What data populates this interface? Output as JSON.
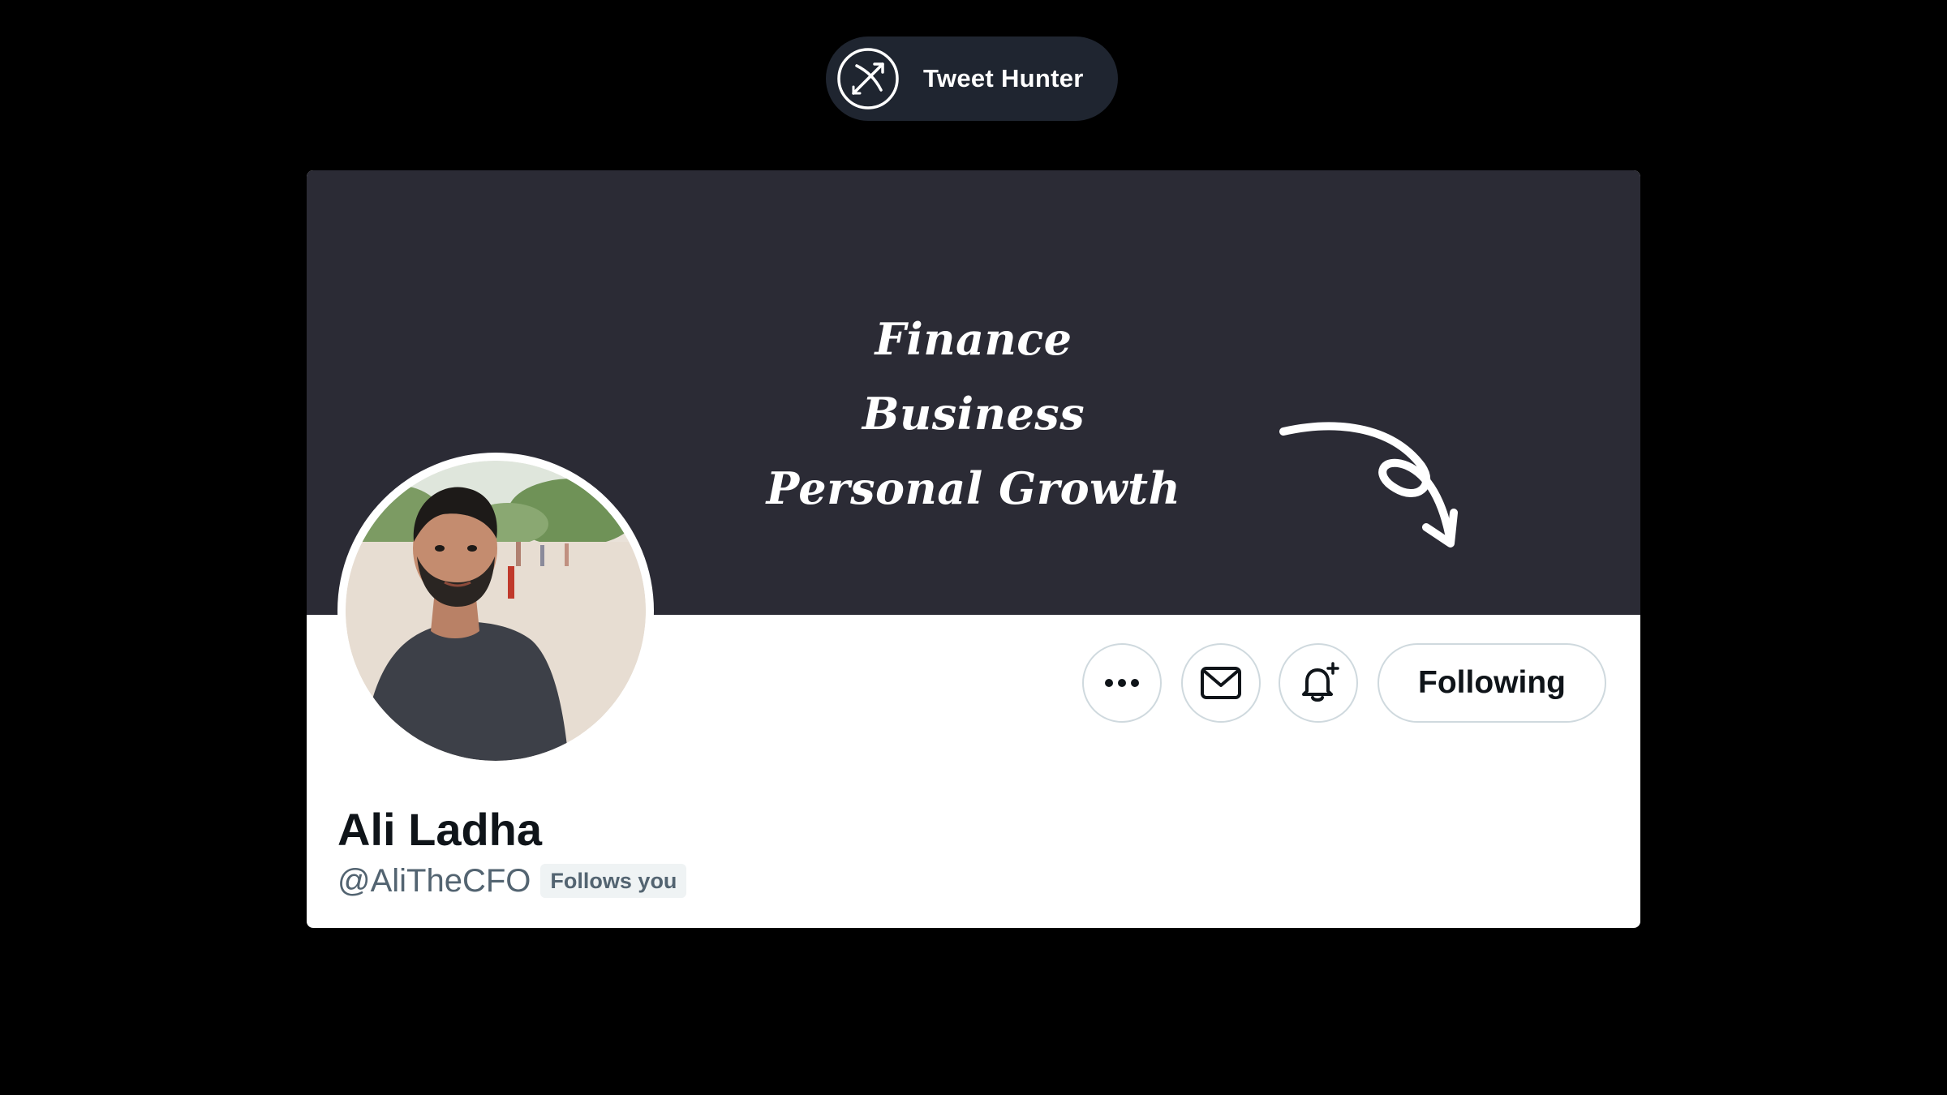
{
  "brand": {
    "name": "Tweet Hunter",
    "logo_icon": "bow-and-arrow-icon"
  },
  "banner": {
    "lines": [
      "Finance",
      "Business",
      "Personal Growth"
    ],
    "background": "#2b2b35",
    "arrow_icon": "curly-arrow-icon"
  },
  "profile": {
    "display_name": "Ali Ladha",
    "handle": "@AliTheCFO",
    "follows_badge": "Follows you"
  },
  "actions": {
    "more_icon": "more-options-icon",
    "message_icon": "envelope-icon",
    "notify_icon": "bell-plus-icon",
    "following_label": "Following"
  },
  "colors": {
    "page_background": "#000000",
    "card_background": "#ffffff",
    "text_primary": "#0f1419",
    "text_secondary": "#536471",
    "border": "#cfd9de",
    "pill_background": "#1f2530"
  }
}
